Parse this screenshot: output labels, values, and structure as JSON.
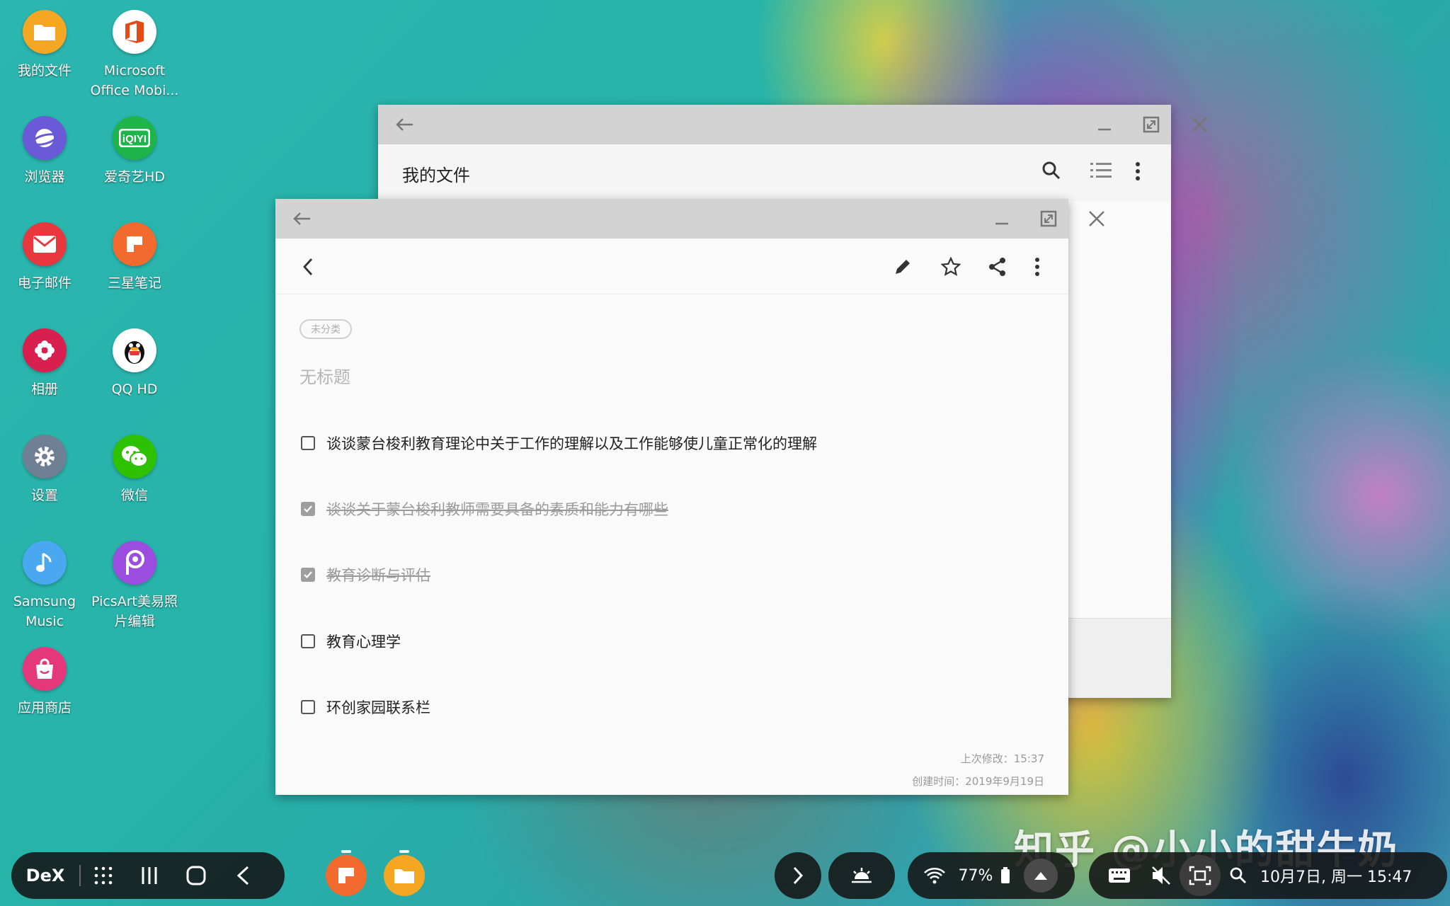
{
  "desktop": {
    "icons": [
      {
        "label": "我的文件",
        "icon": "folder-icon",
        "color": "#f5a623"
      },
      {
        "label": "Microsoft Office Mobi...",
        "icon": "office-icon",
        "color": "#ffffff"
      },
      {
        "label": "浏览器",
        "icon": "browser-icon",
        "color": "#6a5ad8"
      },
      {
        "label": "爱奇艺HD",
        "icon": "iqiyi-icon",
        "color": "#1fb44a"
      },
      {
        "label": "电子邮件",
        "icon": "email-icon",
        "color": "#e8383d"
      },
      {
        "label": "三星笔记",
        "icon": "samsung-notes-icon",
        "color": "#f26a2e"
      },
      {
        "label": "相册",
        "icon": "gallery-icon",
        "color": "#d81f4e"
      },
      {
        "label": "QQ HD",
        "icon": "qq-icon",
        "color": "#ffffff"
      },
      {
        "label": "设置",
        "icon": "settings-icon",
        "color": "#6f7f94"
      },
      {
        "label": "微信",
        "icon": "wechat-icon",
        "color": "#2dc100"
      },
      {
        "label": "Samsung Music",
        "icon": "music-icon",
        "color": "#4aa8f0"
      },
      {
        "label": "PicsArt美易照片编辑",
        "icon": "picsart-icon",
        "color": "#9b4de0"
      },
      {
        "label": "应用商店",
        "icon": "app-store-icon",
        "color": "#e5387a"
      }
    ]
  },
  "files_window": {
    "title": "我的文件"
  },
  "notes_window": {
    "category": "未分类",
    "title": "无标题",
    "tasks": [
      {
        "text": "谈谈蒙台梭利教育理论中关于工作的理解以及工作能够使儿童正常化的理解",
        "done": false
      },
      {
        "text": "谈谈关于蒙台梭利教师需要具备的素质和能力有哪些",
        "done": true
      },
      {
        "text": "教育诊断与评估",
        "done": true
      },
      {
        "text": "教育心理学",
        "done": false
      },
      {
        "text": "环创家园联系栏",
        "done": false
      }
    ],
    "last_modified": "上次修改：15:37",
    "created": "创建时间：2019年9月19日"
  },
  "taskbar": {
    "dex_label": "DeX",
    "battery": "77%",
    "datetime": "10月7日, 周一 15:47"
  },
  "watermark": "知乎 @小小的甜牛奶"
}
